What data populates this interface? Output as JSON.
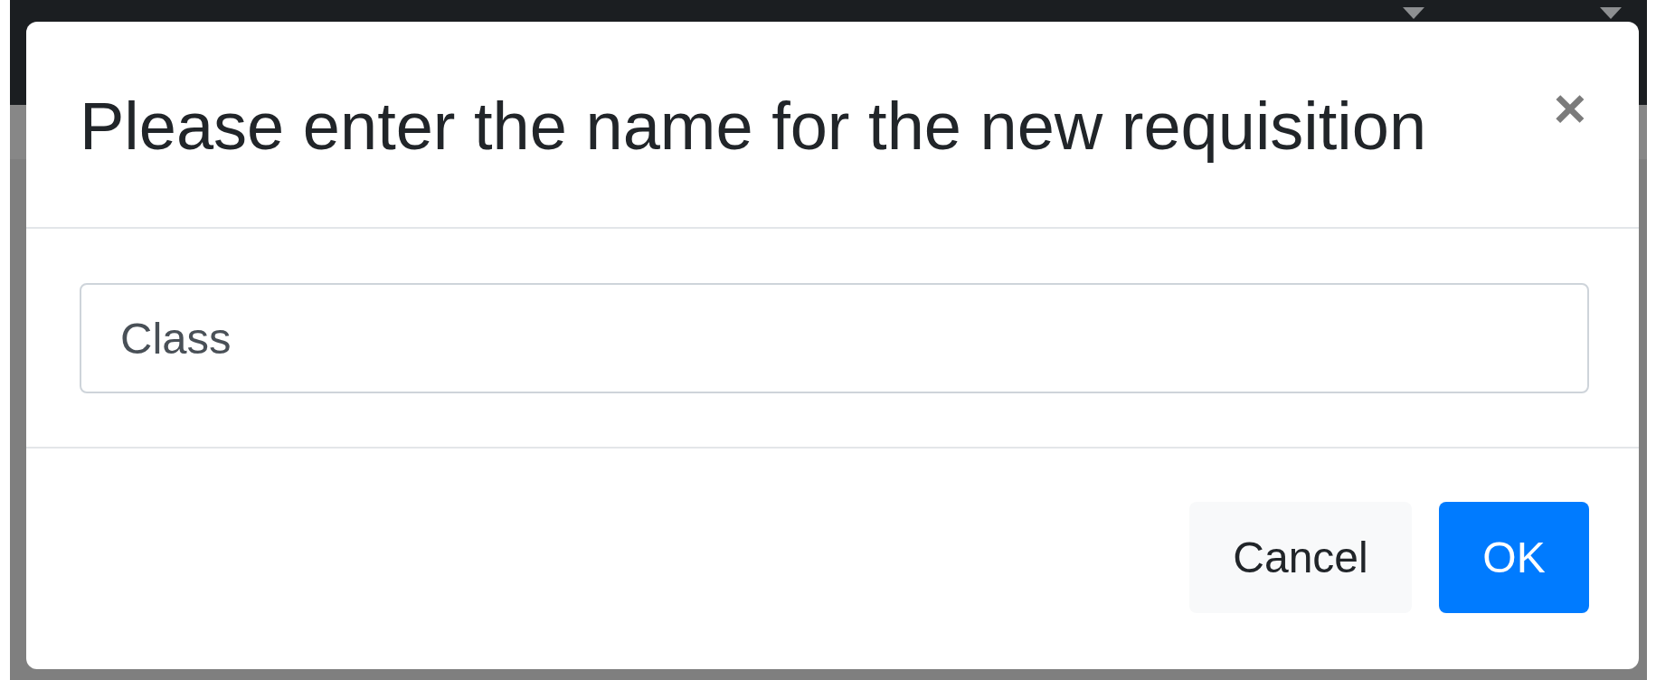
{
  "dialog": {
    "title": "Please enter the name for the new requisition",
    "close_label": "×",
    "field": {
      "value": "Class"
    },
    "buttons": [
      {
        "label": "Cancel",
        "kind": "secondary"
      },
      {
        "label": "OK",
        "kind": "primary"
      }
    ]
  }
}
